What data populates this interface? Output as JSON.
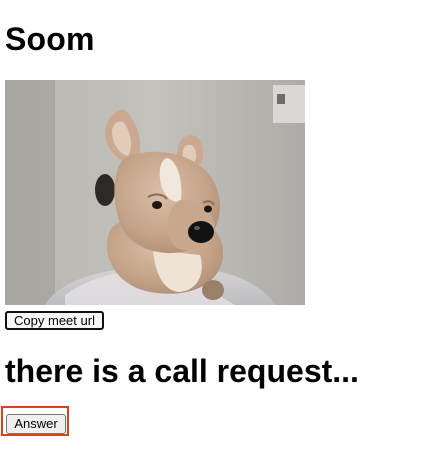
{
  "page": {
    "title": "Soom"
  },
  "video": {
    "icon": "camera-feed-plush-dog"
  },
  "buttons": {
    "copy_meet_url": "Copy meet url",
    "answer": "Answer"
  },
  "call": {
    "heading": "there is a call request..."
  },
  "colors": {
    "highlight": "#d8431f"
  }
}
